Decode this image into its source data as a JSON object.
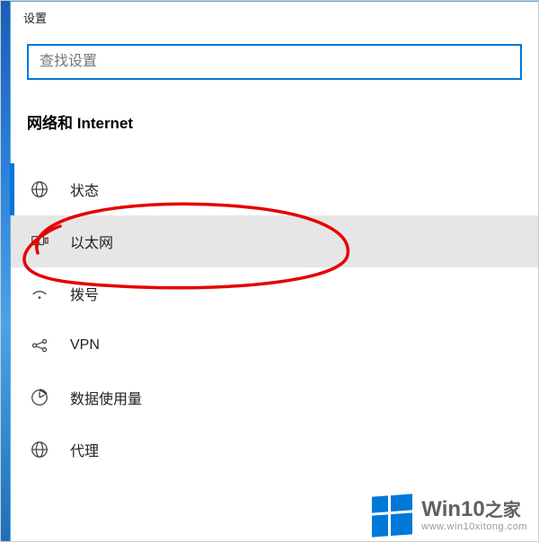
{
  "window": {
    "title": "设置"
  },
  "search": {
    "placeholder": "查找设置",
    "value": ""
  },
  "section": {
    "title": "网络和 Internet"
  },
  "menu": {
    "items": [
      {
        "label": "状态",
        "icon": "globe-icon",
        "active": true,
        "selected": false
      },
      {
        "label": "以太网",
        "icon": "ethernet-icon",
        "active": false,
        "selected": true
      },
      {
        "label": "拨号",
        "icon": "dialup-icon",
        "active": false,
        "selected": false
      },
      {
        "label": "VPN",
        "icon": "vpn-icon",
        "active": false,
        "selected": false
      },
      {
        "label": "数据使用量",
        "icon": "data-usage-icon",
        "active": false,
        "selected": false
      },
      {
        "label": "代理",
        "icon": "proxy-icon",
        "active": false,
        "selected": false
      }
    ]
  },
  "watermark": {
    "brand": "Win10",
    "brand_suffix": "之家",
    "url": "www.win10xitong.com"
  }
}
